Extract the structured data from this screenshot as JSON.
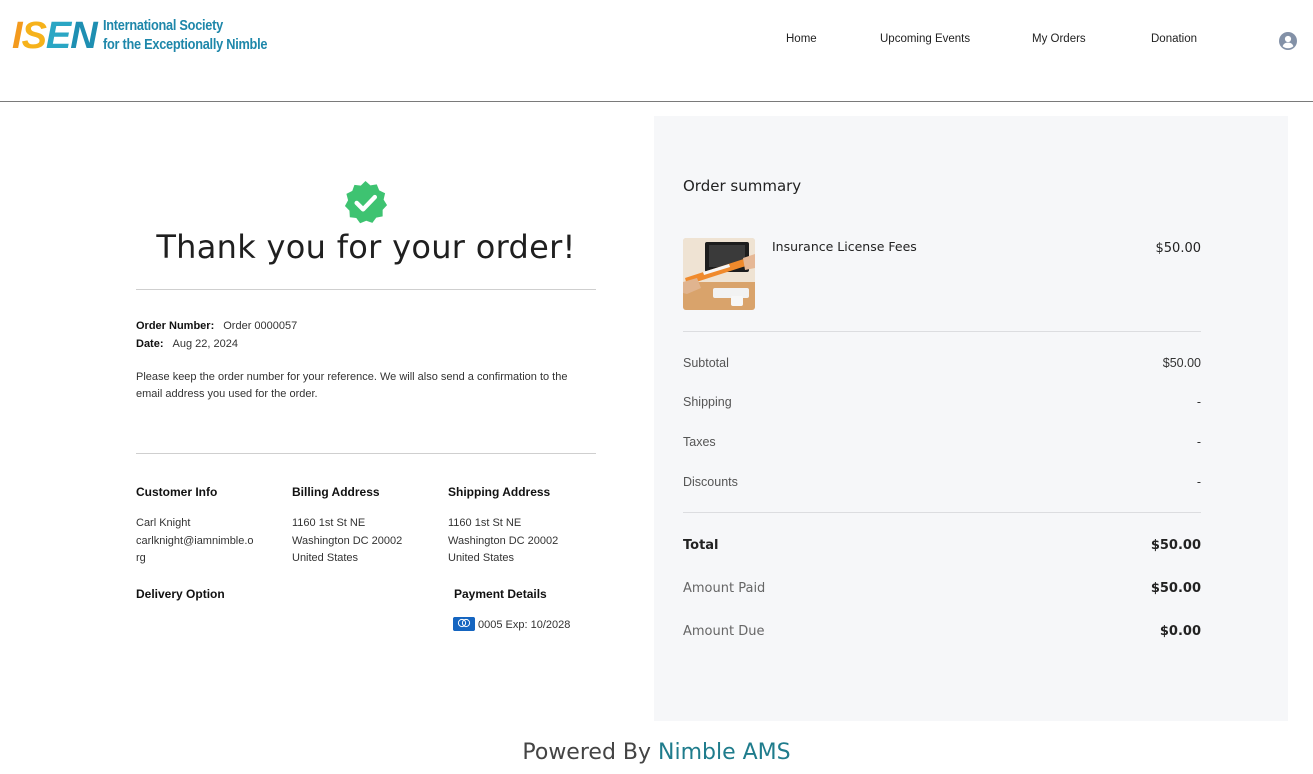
{
  "header": {
    "logo_letters": [
      "I",
      "S",
      "E",
      "N"
    ],
    "logo_line1": "International Society",
    "logo_line2": "for the Exceptionally Nimble",
    "nav": {
      "home": "Home",
      "events": "Upcoming Events",
      "orders": "My Orders",
      "donation": "Donation"
    },
    "user_icon": "user-circle-icon"
  },
  "confirmation": {
    "icon": "check-badge-icon",
    "title": "Thank you for your order!",
    "order_number_label": "Order Number:",
    "order_number": "Order 0000057",
    "date_label": "Date:",
    "date": "Aug 22, 2024",
    "note": "Please keep the order number for your reference. We will also send a confirmation to the email address you used for the order."
  },
  "details": {
    "customer_info": {
      "heading": "Customer Info",
      "name": "Carl Knight",
      "email_line1": "carlknight@iamnimble.o",
      "email_line2": "rg"
    },
    "billing": {
      "heading": "Billing Address",
      "line1": "1160 1st St NE",
      "line2": "Washington DC 20002",
      "line3": "United States"
    },
    "shipping": {
      "heading": "Shipping Address",
      "line1": "1160 1st St NE",
      "line2": "Washington DC 20002",
      "line3": "United States"
    },
    "delivery_heading": "Delivery Option",
    "payment": {
      "heading": "Payment Details",
      "card_icon": "credit-card-icon",
      "card_text": "0005 Exp: 10/2028"
    }
  },
  "summary": {
    "title": "Order summary",
    "item": {
      "name": "Insurance License Fees",
      "price": "$50.00"
    },
    "rows": {
      "subtotal_label": "Subtotal",
      "subtotal": "$50.00",
      "shipping_label": "Shipping",
      "shipping": "-",
      "taxes_label": "Taxes",
      "taxes": "-",
      "discounts_label": "Discounts",
      "discounts": "-"
    },
    "total_label": "Total",
    "total": "$50.00",
    "paid_label": "Amount Paid",
    "paid": "$50.00",
    "due_label": "Amount Due",
    "due": "$0.00"
  },
  "footer": {
    "prefix": "Powered By ",
    "brand": "Nimble AMS"
  },
  "colors": {
    "accent": "#1f7c8c",
    "success": "#3ec371",
    "card": "#1565c0"
  }
}
